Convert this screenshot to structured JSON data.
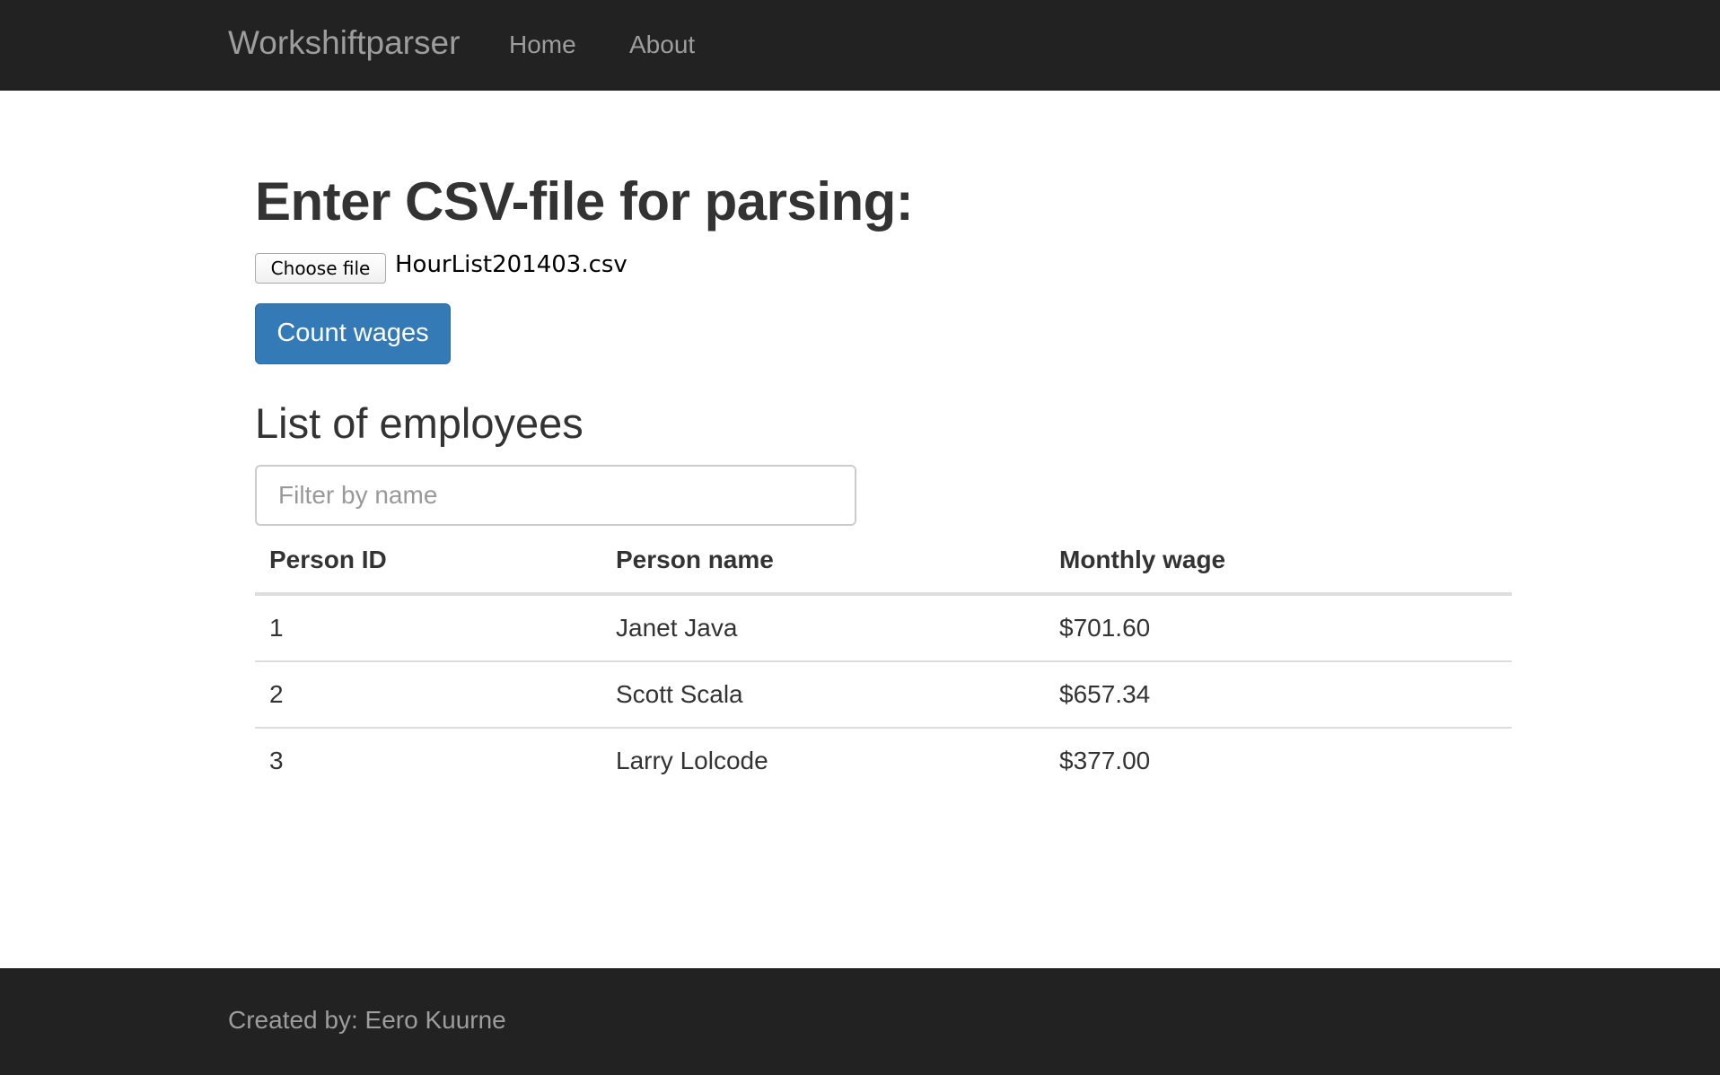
{
  "navbar": {
    "brand": "Workshiftparser",
    "links": [
      {
        "label": "Home"
      },
      {
        "label": "About"
      }
    ]
  },
  "main": {
    "heading": "Enter CSV-file for parsing:",
    "file_input": {
      "button_label": "Choose file",
      "file_name": "HourList201403.csv"
    },
    "submit_label": "Count wages",
    "list_heading": "List of employees",
    "filter": {
      "placeholder": "Filter by name",
      "value": ""
    },
    "table": {
      "columns": [
        "Person ID",
        "Person name",
        "Monthly wage"
      ],
      "rows": [
        [
          "1",
          "Janet Java",
          "$701.60"
        ],
        [
          "2",
          "Scott Scala",
          "$657.34"
        ],
        [
          "3",
          "Larry Lolcode",
          "$377.00"
        ]
      ]
    }
  },
  "footer": {
    "text": "Created by: Eero Kuurne"
  },
  "colors": {
    "navbar_bg": "#222222",
    "nav_text": "#9d9d9d",
    "primary_button": "#337ab7"
  }
}
